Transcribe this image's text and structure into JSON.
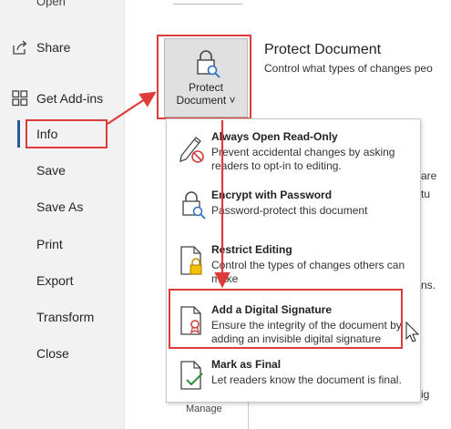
{
  "sidebar": {
    "top_cut_label": "Open",
    "items": [
      {
        "label": "Share"
      },
      {
        "label": "Get Add-ins"
      },
      {
        "label": "Info"
      },
      {
        "label": "Save"
      },
      {
        "label": "Save As"
      },
      {
        "label": "Print"
      },
      {
        "label": "Export"
      },
      {
        "label": "Transform"
      },
      {
        "label": "Close"
      }
    ]
  },
  "protect": {
    "button_line1": "Protect",
    "button_line2": "Document ˅",
    "title": "Protect Document",
    "description": "Control what types of changes peo"
  },
  "menu": {
    "items": [
      {
        "title": "Always Open Read-Only",
        "desc": "Prevent accidental changes by asking readers to opt-in to editing.",
        "icon": "pencil-no-icon"
      },
      {
        "title": "Encrypt with Password",
        "desc": "Password-protect this document",
        "icon": "lock-key-icon"
      },
      {
        "title": "Restrict Editing",
        "desc": "Control the types of changes others can make",
        "icon": "doc-lock-icon"
      },
      {
        "title": "Add a Digital Signature",
        "desc": "Ensure the integrity of the document by adding an invisible digital signature",
        "icon": "doc-ribbon-icon"
      },
      {
        "title": "Mark as Final",
        "desc": "Let readers know the document is final.",
        "icon": "doc-check-icon"
      }
    ]
  },
  "background": {
    "frag1": "are",
    "frag2": "tu",
    "frag3": "ns.",
    "frag4": "ig",
    "manage": "Manage"
  },
  "colors": {
    "highlight": "#e03b3b",
    "accent": "#2b579a",
    "sidebar_bg": "#f2f2f2"
  }
}
